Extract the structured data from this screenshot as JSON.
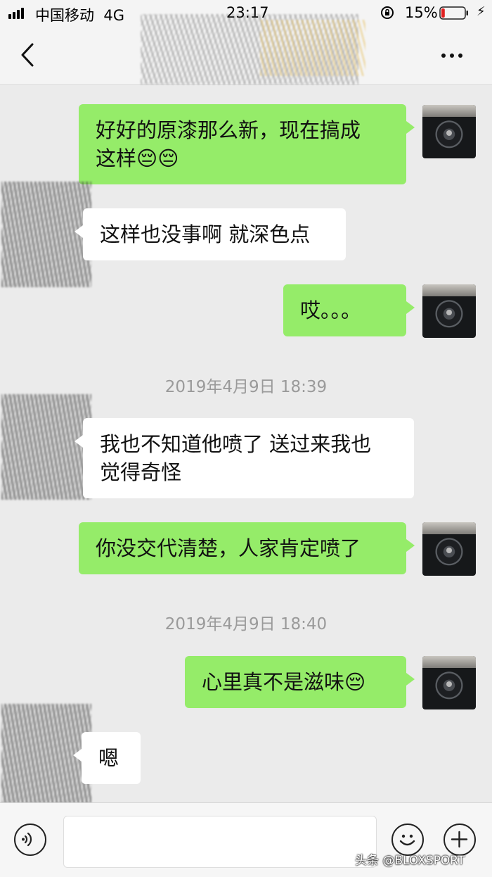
{
  "status_bar": {
    "carrier": "中国移动",
    "network": "4G",
    "time": "23:17",
    "battery_percent": "15%",
    "battery_level": 0.15
  },
  "messages": [
    {
      "direction": "sent",
      "text_lines": [
        "好好的原漆那么新，现在搞成",
        "这样😔😔"
      ]
    },
    {
      "direction": "received",
      "text_lines": [
        "这样也没事啊 就深色点"
      ]
    },
    {
      "direction": "sent",
      "text_lines": [
        "哎。。。"
      ]
    },
    {
      "direction": "timestamp",
      "text": "2019年4月9日 18:39"
    },
    {
      "direction": "received",
      "text_lines": [
        "我也不知道他喷了 送过来我也",
        "觉得奇怪"
      ]
    },
    {
      "direction": "sent",
      "text_lines": [
        "你没交代清楚，人家肯定喷了"
      ]
    },
    {
      "direction": "timestamp",
      "text": "2019年4月9日 18:40"
    },
    {
      "direction": "sent",
      "text_lines": [
        "心里真不是滋味😔"
      ]
    },
    {
      "direction": "received",
      "text_lines": [
        "嗯"
      ]
    }
  ],
  "watermark": "头条 @BLOXSPORT",
  "colors": {
    "sent_bubble": "#95ec69",
    "received_bubble": "#ffffff",
    "chat_background": "#ebebeb"
  },
  "icons": {
    "back": "chevron-left-icon",
    "more": "more-dots-icon",
    "voice": "voice-icon",
    "emoji": "emoji-icon",
    "plus": "plus-icon"
  }
}
